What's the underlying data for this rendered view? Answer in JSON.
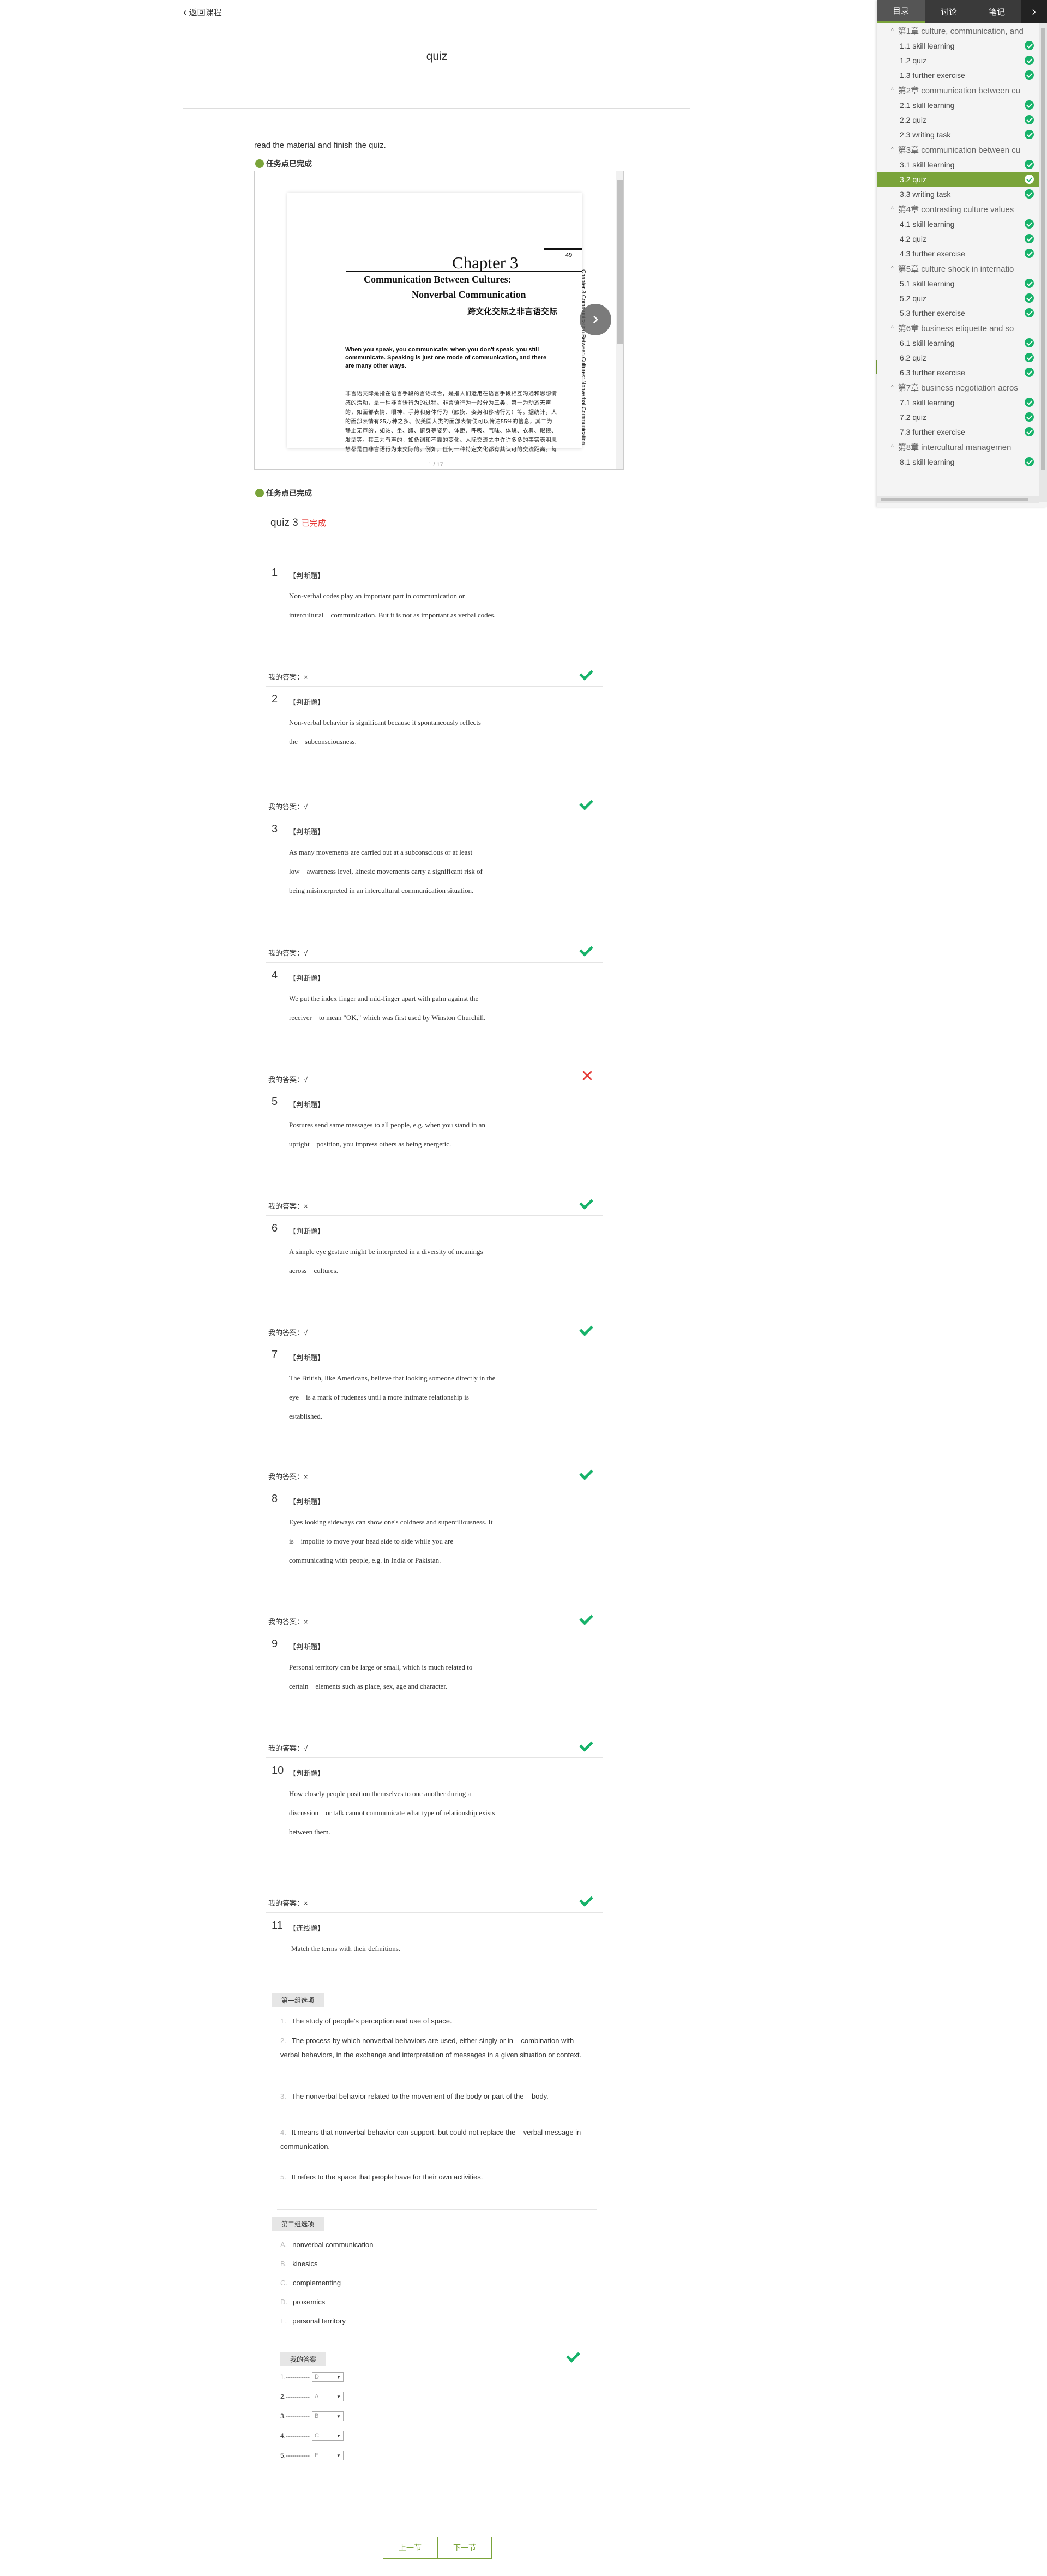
{
  "nav": {
    "back_label": "返回课程"
  },
  "page": {
    "title": "quiz",
    "instruction": "read the material and finish the quiz."
  },
  "task_status": "任务点已完成",
  "doc": {
    "pager": "1 / 17",
    "chapter_label": "Chapter 3",
    "page_number": "49",
    "title_line1": "Communication Between Cultures:",
    "title_line2": "Nonverbal Communication",
    "title_cn": "跨文化交际之非言语交际",
    "intro": "When you speak, you communicate; when you don't speak, you still communicate. Speaking is just one mode of communication, and there are many other ways.",
    "body_cn": "非言语交际是指在语言手段的言语场合，是指人们运用在语言手段相互沟通和思想情感的活动，是一种非言语行为的过程。非言语行为一般分为三类，第一为动态无声的，如面部表情、眼神、手势和身体行为（触摸、姿势和移动行为）等。据统计，人的面部表情有25万种之多。仅美国人类的面部表情便可以传达55%的信息，其二为静止无声的，如站、坐、蹲、俯身等姿势、体距、呼吸、气味、体貌、衣着、眼镜、发型等。其三为有声的，如备调和不靠的变化。人际交流之中许许多多的事实表明思想都是由非言语行为来交际的。例如，任何一种特定文化都有其认可的交流距离。每",
    "side_text": "Chapter 3 Communication Between Cultures: Nonverbal Communication"
  },
  "quiz": {
    "name": "quiz 3",
    "status": "已完成"
  },
  "labels": {
    "my_answer_prefix": "我的答案：",
    "first_group": "第一组选项",
    "second_group": "第二组选项",
    "my_answer_box": "我的答案",
    "prev": "上一节",
    "next": "下一节"
  },
  "questions": [
    {
      "num": "1",
      "type": "【判断题】",
      "lines": [
        "Non-verbal codes play an important part in communication or",
        "intercultural    communication. But it is not as important as verbal codes."
      ],
      "answer": "×",
      "result": "correct"
    },
    {
      "num": "2",
      "type": "【判断题】",
      "lines": [
        "Non-verbal behavior is significant because it spontaneously reflects",
        "the    subconsciousness."
      ],
      "answer": "√",
      "result": "correct"
    },
    {
      "num": "3",
      "type": "【判断题】",
      "lines": [
        "As many movements are carried out at a subconscious or at least",
        "low    awareness level, kinesic movements carry a significant risk of",
        "being misinterpreted in an intercultural communication situation."
      ],
      "answer": "√",
      "result": "correct"
    },
    {
      "num": "4",
      "type": "【判断题】",
      "lines": [
        "We put the index finger and mid-finger apart with palm against the",
        "receiver    to mean \"OK,\" which was first used by Winston Churchill."
      ],
      "answer": "√",
      "result": "wrong"
    },
    {
      "num": "5",
      "type": "【判断题】",
      "lines": [
        "Postures send same messages to all people, e.g. when you stand in an",
        "upright    position, you impress others as being energetic."
      ],
      "answer": "×",
      "result": "correct"
    },
    {
      "num": "6",
      "type": "【判断题】",
      "lines": [
        "A simple eye gesture might be interpreted in a diversity of meanings",
        "across    cultures."
      ],
      "answer": "√",
      "result": "correct"
    },
    {
      "num": "7",
      "type": "【判断题】",
      "lines": [
        "The British, like Americans, believe that looking someone directly in the",
        "eye    is a mark of rudeness until a more intimate relationship is",
        "established."
      ],
      "answer": "×",
      "result": "correct"
    },
    {
      "num": "8",
      "type": "【判断题】",
      "lines": [
        "Eyes looking sideways can show one's coldness and superciliousness. It",
        "is    impolite to move your head side to side while you are",
        "communicating with people, e.g. in India or Pakistan."
      ],
      "answer": "×",
      "result": "correct"
    },
    {
      "num": "9",
      "type": "【判断题】",
      "lines": [
        "Personal territory can be large or small, which is much related to",
        "certain    elements such as place, sex, age and character."
      ],
      "answer": "√",
      "result": "correct"
    },
    {
      "num": "10",
      "type": "【判断题】",
      "lines": [
        "How closely people position themselves to one another during a",
        "discussion    or talk cannot communicate what type of relationship exists",
        "between them."
      ],
      "answer": "×",
      "result": "correct"
    }
  ],
  "match": {
    "num": "11",
    "type": "【连线题】",
    "prompt": "Match the terms with their definitions.",
    "first": [
      {
        "letter": "1.",
        "text": "The study of people's perception and use of space."
      },
      {
        "letter": "2.",
        "text": "The process by which nonverbal behaviors are used, either singly or in    combination with verbal behaviors, in the exchange and interpretation of messages in a given situation or context."
      },
      {
        "letter": "3.",
        "text": "The nonverbal behavior related to the movement of the body or part of the    body."
      },
      {
        "letter": "4.",
        "text": "It means that nonverbal behavior can support, but could not replace the    verbal message in communication."
      },
      {
        "letter": "5.",
        "text": "It refers to the space that people have for their own activities."
      }
    ],
    "second": [
      {
        "letter": "A.",
        "text": "nonverbal communication"
      },
      {
        "letter": "B.",
        "text": "kinesics"
      },
      {
        "letter": "C.",
        "text": "complementing"
      },
      {
        "letter": "D.",
        "text": "proxemics"
      },
      {
        "letter": "E.",
        "text": "personal territory"
      }
    ],
    "answers": [
      {
        "label": "1.-----------",
        "value": "D"
      },
      {
        "label": "2.-----------",
        "value": "A"
      },
      {
        "label": "3.-----------",
        "value": "B"
      },
      {
        "label": "4.-----------",
        "value": "C"
      },
      {
        "label": "5.-----------",
        "value": "E"
      }
    ]
  },
  "sidebar": {
    "tabs": [
      "目录",
      "讨论",
      "笔记"
    ],
    "chapters": [
      {
        "title": "第1章 culture, communication, and",
        "items": [
          "1.1 skill learning",
          "1.2 quiz",
          "1.3 further exercise"
        ]
      },
      {
        "title": "第2章 communication between cu",
        "items": [
          "2.1 skill learning",
          "2.2 quiz",
          "2.3 writing task"
        ]
      },
      {
        "title": "第3章 communication between cu",
        "items": [
          "3.1 skill learning",
          "3.2 quiz",
          "3.3 writing task"
        ]
      },
      {
        "title": "第4章 contrasting culture values",
        "items": [
          "4.1 skill learning",
          "4.2 quiz",
          "4.3 further exercise"
        ]
      },
      {
        "title": "第5章 culture shock in internatio",
        "items": [
          "5.1 skill learning",
          "5.2 quiz",
          "5.3 further exercise"
        ]
      },
      {
        "title": "第6章 business etiquette and so",
        "items": [
          "6.1 skill learning",
          "6.2 quiz",
          "6.3 further exercise"
        ]
      },
      {
        "title": "第7章 business negotiation acros",
        "items": [
          "7.1 skill learning",
          "7.2 quiz",
          "7.3 further exercise"
        ]
      },
      {
        "title": "第8章 intercultural managemen",
        "items": [
          "8.1 skill learning"
        ]
      }
    ],
    "active_item": "3.2 quiz"
  },
  "colors": {
    "accent_green": "#7aa43a",
    "check_green": "#17b26a",
    "error_red": "#e53935"
  }
}
